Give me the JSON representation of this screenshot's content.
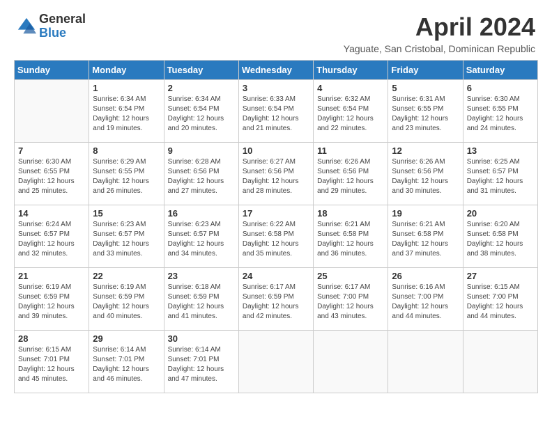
{
  "logo": {
    "general": "General",
    "blue": "Blue"
  },
  "title": "April 2024",
  "subtitle": "Yaguate, San Cristobal, Dominican Republic",
  "days": [
    "Sunday",
    "Monday",
    "Tuesday",
    "Wednesday",
    "Thursday",
    "Friday",
    "Saturday"
  ],
  "weeks": [
    [
      {
        "num": "",
        "empty": true
      },
      {
        "num": "1",
        "sunrise": "Sunrise: 6:34 AM",
        "sunset": "Sunset: 6:54 PM",
        "daylight": "Daylight: 12 hours and 19 minutes."
      },
      {
        "num": "2",
        "sunrise": "Sunrise: 6:34 AM",
        "sunset": "Sunset: 6:54 PM",
        "daylight": "Daylight: 12 hours and 20 minutes."
      },
      {
        "num": "3",
        "sunrise": "Sunrise: 6:33 AM",
        "sunset": "Sunset: 6:54 PM",
        "daylight": "Daylight: 12 hours and 21 minutes."
      },
      {
        "num": "4",
        "sunrise": "Sunrise: 6:32 AM",
        "sunset": "Sunset: 6:54 PM",
        "daylight": "Daylight: 12 hours and 22 minutes."
      },
      {
        "num": "5",
        "sunrise": "Sunrise: 6:31 AM",
        "sunset": "Sunset: 6:55 PM",
        "daylight": "Daylight: 12 hours and 23 minutes."
      },
      {
        "num": "6",
        "sunrise": "Sunrise: 6:30 AM",
        "sunset": "Sunset: 6:55 PM",
        "daylight": "Daylight: 12 hours and 24 minutes."
      }
    ],
    [
      {
        "num": "7",
        "sunrise": "Sunrise: 6:30 AM",
        "sunset": "Sunset: 6:55 PM",
        "daylight": "Daylight: 12 hours and 25 minutes."
      },
      {
        "num": "8",
        "sunrise": "Sunrise: 6:29 AM",
        "sunset": "Sunset: 6:55 PM",
        "daylight": "Daylight: 12 hours and 26 minutes."
      },
      {
        "num": "9",
        "sunrise": "Sunrise: 6:28 AM",
        "sunset": "Sunset: 6:56 PM",
        "daylight": "Daylight: 12 hours and 27 minutes."
      },
      {
        "num": "10",
        "sunrise": "Sunrise: 6:27 AM",
        "sunset": "Sunset: 6:56 PM",
        "daylight": "Daylight: 12 hours and 28 minutes."
      },
      {
        "num": "11",
        "sunrise": "Sunrise: 6:26 AM",
        "sunset": "Sunset: 6:56 PM",
        "daylight": "Daylight: 12 hours and 29 minutes."
      },
      {
        "num": "12",
        "sunrise": "Sunrise: 6:26 AM",
        "sunset": "Sunset: 6:56 PM",
        "daylight": "Daylight: 12 hours and 30 minutes."
      },
      {
        "num": "13",
        "sunrise": "Sunrise: 6:25 AM",
        "sunset": "Sunset: 6:57 PM",
        "daylight": "Daylight: 12 hours and 31 minutes."
      }
    ],
    [
      {
        "num": "14",
        "sunrise": "Sunrise: 6:24 AM",
        "sunset": "Sunset: 6:57 PM",
        "daylight": "Daylight: 12 hours and 32 minutes."
      },
      {
        "num": "15",
        "sunrise": "Sunrise: 6:23 AM",
        "sunset": "Sunset: 6:57 PM",
        "daylight": "Daylight: 12 hours and 33 minutes."
      },
      {
        "num": "16",
        "sunrise": "Sunrise: 6:23 AM",
        "sunset": "Sunset: 6:57 PM",
        "daylight": "Daylight: 12 hours and 34 minutes."
      },
      {
        "num": "17",
        "sunrise": "Sunrise: 6:22 AM",
        "sunset": "Sunset: 6:58 PM",
        "daylight": "Daylight: 12 hours and 35 minutes."
      },
      {
        "num": "18",
        "sunrise": "Sunrise: 6:21 AM",
        "sunset": "Sunset: 6:58 PM",
        "daylight": "Daylight: 12 hours and 36 minutes."
      },
      {
        "num": "19",
        "sunrise": "Sunrise: 6:21 AM",
        "sunset": "Sunset: 6:58 PM",
        "daylight": "Daylight: 12 hours and 37 minutes."
      },
      {
        "num": "20",
        "sunrise": "Sunrise: 6:20 AM",
        "sunset": "Sunset: 6:58 PM",
        "daylight": "Daylight: 12 hours and 38 minutes."
      }
    ],
    [
      {
        "num": "21",
        "sunrise": "Sunrise: 6:19 AM",
        "sunset": "Sunset: 6:59 PM",
        "daylight": "Daylight: 12 hours and 39 minutes."
      },
      {
        "num": "22",
        "sunrise": "Sunrise: 6:19 AM",
        "sunset": "Sunset: 6:59 PM",
        "daylight": "Daylight: 12 hours and 40 minutes."
      },
      {
        "num": "23",
        "sunrise": "Sunrise: 6:18 AM",
        "sunset": "Sunset: 6:59 PM",
        "daylight": "Daylight: 12 hours and 41 minutes."
      },
      {
        "num": "24",
        "sunrise": "Sunrise: 6:17 AM",
        "sunset": "Sunset: 6:59 PM",
        "daylight": "Daylight: 12 hours and 42 minutes."
      },
      {
        "num": "25",
        "sunrise": "Sunrise: 6:17 AM",
        "sunset": "Sunset: 7:00 PM",
        "daylight": "Daylight: 12 hours and 43 minutes."
      },
      {
        "num": "26",
        "sunrise": "Sunrise: 6:16 AM",
        "sunset": "Sunset: 7:00 PM",
        "daylight": "Daylight: 12 hours and 44 minutes."
      },
      {
        "num": "27",
        "sunrise": "Sunrise: 6:15 AM",
        "sunset": "Sunset: 7:00 PM",
        "daylight": "Daylight: 12 hours and 44 minutes."
      }
    ],
    [
      {
        "num": "28",
        "sunrise": "Sunrise: 6:15 AM",
        "sunset": "Sunset: 7:01 PM",
        "daylight": "Daylight: 12 hours and 45 minutes."
      },
      {
        "num": "29",
        "sunrise": "Sunrise: 6:14 AM",
        "sunset": "Sunset: 7:01 PM",
        "daylight": "Daylight: 12 hours and 46 minutes."
      },
      {
        "num": "30",
        "sunrise": "Sunrise: 6:14 AM",
        "sunset": "Sunset: 7:01 PM",
        "daylight": "Daylight: 12 hours and 47 minutes."
      },
      {
        "num": "",
        "empty": true
      },
      {
        "num": "",
        "empty": true
      },
      {
        "num": "",
        "empty": true
      },
      {
        "num": "",
        "empty": true
      }
    ]
  ]
}
